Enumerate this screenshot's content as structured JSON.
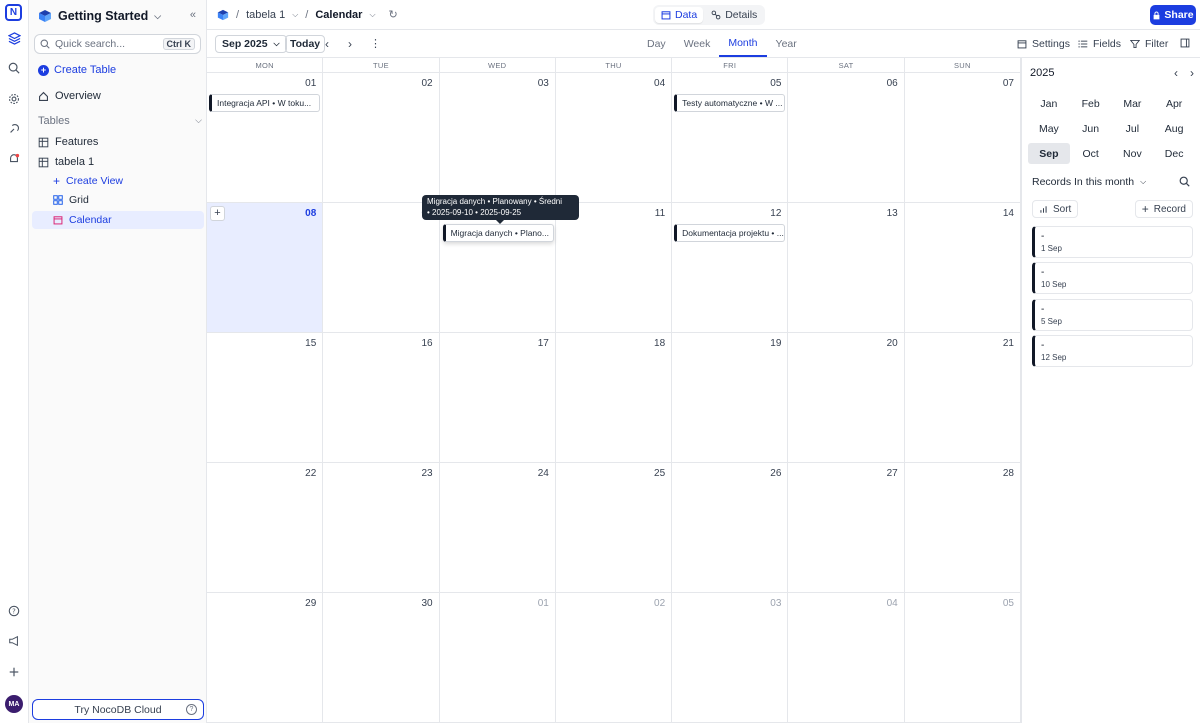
{
  "rail": {
    "logo_letter": "N",
    "avatar_initials": "MA"
  },
  "sidebar": {
    "workspace": "Getting Started",
    "search_placeholder": "Quick search...",
    "search_shortcut": "Ctrl K",
    "create_table": "Create Table",
    "overview": "Overview",
    "tables_header": "Tables",
    "tables": [
      {
        "label": "Features"
      },
      {
        "label": "tabela 1"
      }
    ],
    "views": [
      {
        "label": "Create View"
      },
      {
        "label": "Grid"
      },
      {
        "label": "Calendar"
      }
    ],
    "try_cloud": "Try NocoDB Cloud"
  },
  "topbar": {
    "crumb_table": "tabela 1",
    "crumb_view": "Calendar",
    "tab_data": "Data",
    "tab_details": "Details",
    "share": "Share"
  },
  "toolbar": {
    "month": "Sep 2025",
    "today": "Today",
    "view_modes": [
      "Day",
      "Week",
      "Month",
      "Year"
    ],
    "active_mode": "Month",
    "settings": "Settings",
    "fields": "Fields",
    "filter": "Filter"
  },
  "calendar": {
    "weekdays": [
      "MON",
      "TUE",
      "WED",
      "THU",
      "FRI",
      "SAT",
      "SUN"
    ],
    "weeks": [
      [
        "01",
        "02",
        "03",
        "04",
        "05",
        "06",
        "07"
      ],
      [
        "08",
        "09",
        "10",
        "11",
        "12",
        "13",
        "14"
      ],
      [
        "15",
        "16",
        "17",
        "18",
        "19",
        "20",
        "21"
      ],
      [
        "22",
        "23",
        "24",
        "25",
        "26",
        "27",
        "28"
      ],
      [
        "29",
        "30",
        "01",
        "02",
        "03",
        "04",
        "05"
      ]
    ],
    "events": [
      {
        "label": "Integracja API • W toku..."
      },
      {
        "label": "Testy automatyczne • W ..."
      },
      {
        "label": "Migracja danych • Plano..."
      },
      {
        "label": "Dokumentacja projektu • ..."
      }
    ],
    "tooltip_line1": "Migracja danych • Planowany • Średni",
    "tooltip_line2": "• 2025-09-10 • 2025-09-25"
  },
  "panel": {
    "year": "2025",
    "months": [
      "Jan",
      "Feb",
      "Mar",
      "Apr",
      "May",
      "Jun",
      "Jul",
      "Aug",
      "Sep",
      "Oct",
      "Nov",
      "Dec"
    ],
    "active_month": "Sep",
    "records_filter": "Records In this month",
    "sort": "Sort",
    "record": "Record",
    "records": [
      {
        "title": "-",
        "date": "1 Sep"
      },
      {
        "title": "-",
        "date": "10 Sep"
      },
      {
        "title": "-",
        "date": "5 Sep"
      },
      {
        "title": "-",
        "date": "12 Sep"
      }
    ]
  },
  "colors": {
    "accent": "#1c3de0",
    "today_bg": "#e8edff",
    "event_bar": "#111827"
  }
}
